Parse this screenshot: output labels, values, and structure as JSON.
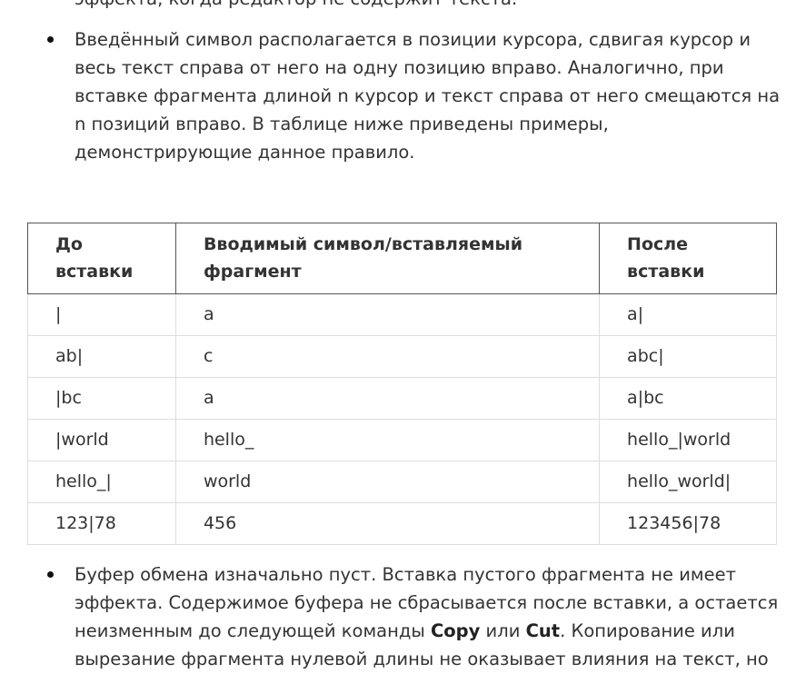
{
  "paragraph_top_partial": "эффекта, когда редактор не содержит текста.",
  "bullet_insert": {
    "lines": [
      "Введённый символ располагается в позиции курсора, сдвигая курсор и",
      "весь текст справа от него на одну позицию вправо. Аналогично, при",
      "вставке фрагмента длиной n курсор и текст справа от него смещаются на",
      "n позиций вправо. В таблице ниже приведены примеры,",
      "демонстрирующие данное правило."
    ]
  },
  "table": {
    "headers": {
      "col1_line1": "До",
      "col1_line2": "вставки",
      "col2_line1": "Вводимый символ/вставляемый",
      "col2_line2": "фрагмент",
      "col3_line1": "После",
      "col3_line2": "вставки"
    },
    "rows": [
      {
        "before": "|",
        "input": "a",
        "after": "a|"
      },
      {
        "before": "ab|",
        "input": "c",
        "after": "abc|"
      },
      {
        "before": "|bc",
        "input": "a",
        "after": "a|bc"
      },
      {
        "before": "|world",
        "input": "hello_",
        "after": "hello_|world"
      },
      {
        "before": "hello_|",
        "input": "world",
        "after": "hello_world|"
      },
      {
        "before": "123|78",
        "input": "456",
        "after": "123456|78"
      }
    ]
  },
  "bullet_buffer": {
    "line1": "Буфер обмена изначально пуст. Вставка пустого фрагмента не имеет",
    "line2": "эффекта. Содержимое буфера не сбрасывается после вставки, а остается",
    "line3_prefix": "неизменным до следующей команды ",
    "line3_kw1": "Copy",
    "line3_mid": " или ",
    "line3_kw2": "Cut",
    "line3_suffix": ". Копирование или",
    "line4": "вырезание фрагмента нулевой длины не оказывает влияния на текст, но"
  }
}
